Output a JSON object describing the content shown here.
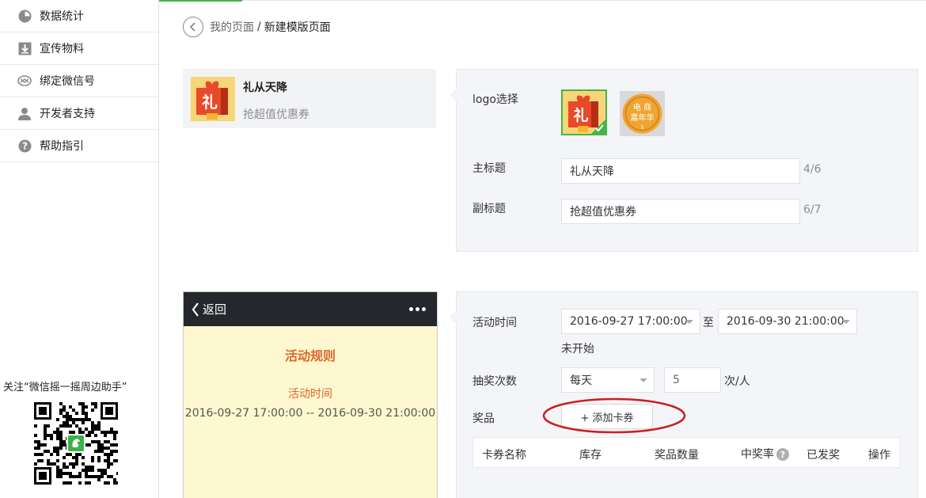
{
  "sidebar": {
    "items": [
      {
        "icon": "pie-chart-icon",
        "label": "数据统计"
      },
      {
        "icon": "download-icon",
        "label": "宣传物料"
      },
      {
        "icon": "wechat-link-icon",
        "label": "绑定微信号"
      },
      {
        "icon": "user-icon",
        "label": "开发者支持"
      },
      {
        "icon": "question-icon",
        "label": "帮助指引"
      }
    ],
    "qr_text": "关注“微信摇一摇周边助手”"
  },
  "breadcrumb": {
    "parent": "我的页面",
    "separator": "/",
    "current": "新建模版页面"
  },
  "preview": {
    "logo_char": "礼",
    "title": "礼从天降",
    "subtitle": "抢超值优惠券"
  },
  "form": {
    "logo_label": "logo选择",
    "logo_options": [
      {
        "char": "礼",
        "selected": true
      },
      {
        "text_top": "电 商",
        "text_mid": "嘉年华",
        "text_bot": "S",
        "selected": false
      }
    ],
    "title_label": "主标题",
    "title_value": "礼从天降",
    "title_count": "4/6",
    "subtitle_label": "副标题",
    "subtitle_value": "抢超值优惠券",
    "subtitle_count": "6/7"
  },
  "phone": {
    "back_label": "返回",
    "rules_title": "活动规则",
    "time_title": "活动时间",
    "time_range": "2016-09-27 17:00:00 -- 2016-09-30 21:00:00"
  },
  "activity": {
    "time_label": "活动时间",
    "start": "2016-09-27 17:00:00",
    "to": "至",
    "end": "2016-09-30 21:00:00",
    "status": "未开始",
    "draws_label": "抽奖次数",
    "draws_freq": "每天",
    "draws_count": "5",
    "draws_unit": "次/人",
    "prize_label": "奖品",
    "add_card_label": "+ 添加卡券",
    "table_headers": [
      "卡券名称",
      "库存",
      "奖品数量",
      "中奖率",
      "已发奖",
      "操作"
    ],
    "help_mark": "?"
  },
  "colors": {
    "accent": "#44b549",
    "highlight": "#e1642b",
    "annotation": "#cc1f1f"
  }
}
